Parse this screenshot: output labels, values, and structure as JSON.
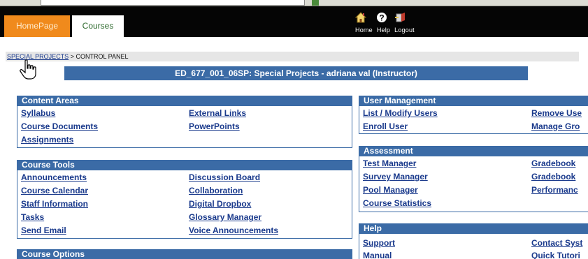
{
  "tabs": {
    "home": "HomePage",
    "courses": "Courses"
  },
  "toolbar": {
    "home_label": "Home",
    "help_label": "Help",
    "logout_label": "Logout"
  },
  "breadcrumb": {
    "link": "SPECIAL PROJECTS",
    "separator": ">",
    "current": "CONTROL PANEL"
  },
  "course_banner": "ED_677_001_06SP: Special Projects - adriana val (Instructor)",
  "content_areas": {
    "title": "Content Areas",
    "links": [
      "Syllabus",
      "External Links",
      "Course Documents",
      "PowerPoints",
      "Assignments"
    ]
  },
  "course_tools": {
    "title": "Course Tools",
    "links": [
      "Announcements",
      "Discussion Board",
      "Course Calendar",
      "Collaboration",
      "Staff Information",
      "Digital Dropbox",
      "Tasks",
      "Glossary Manager",
      "Send Email",
      "Voice Announcements"
    ]
  },
  "course_options": {
    "title": "Course Options"
  },
  "user_management": {
    "title": "User Management",
    "links": [
      "List / Modify Users",
      "Remove Use",
      "Enroll User",
      "Manage Gro"
    ]
  },
  "assessment": {
    "title": "Assessment",
    "links": [
      "Test Manager",
      "Gradebook",
      "Survey Manager",
      "Gradebook",
      "Pool Manager",
      "Performanc",
      "Course Statistics"
    ]
  },
  "help": {
    "title": "Help",
    "links": [
      "Support",
      "Contact Syst",
      "Manual",
      "Quick Tutori"
    ]
  },
  "colors": {
    "panel_blue": "#3b6ba6",
    "link_blue": "#1a3a8c",
    "home_tab_orange": "#f08a1c",
    "header_black": "#050505"
  },
  "icons": [
    "home-icon",
    "help-icon",
    "logout-icon",
    "hand-cursor-icon"
  ]
}
